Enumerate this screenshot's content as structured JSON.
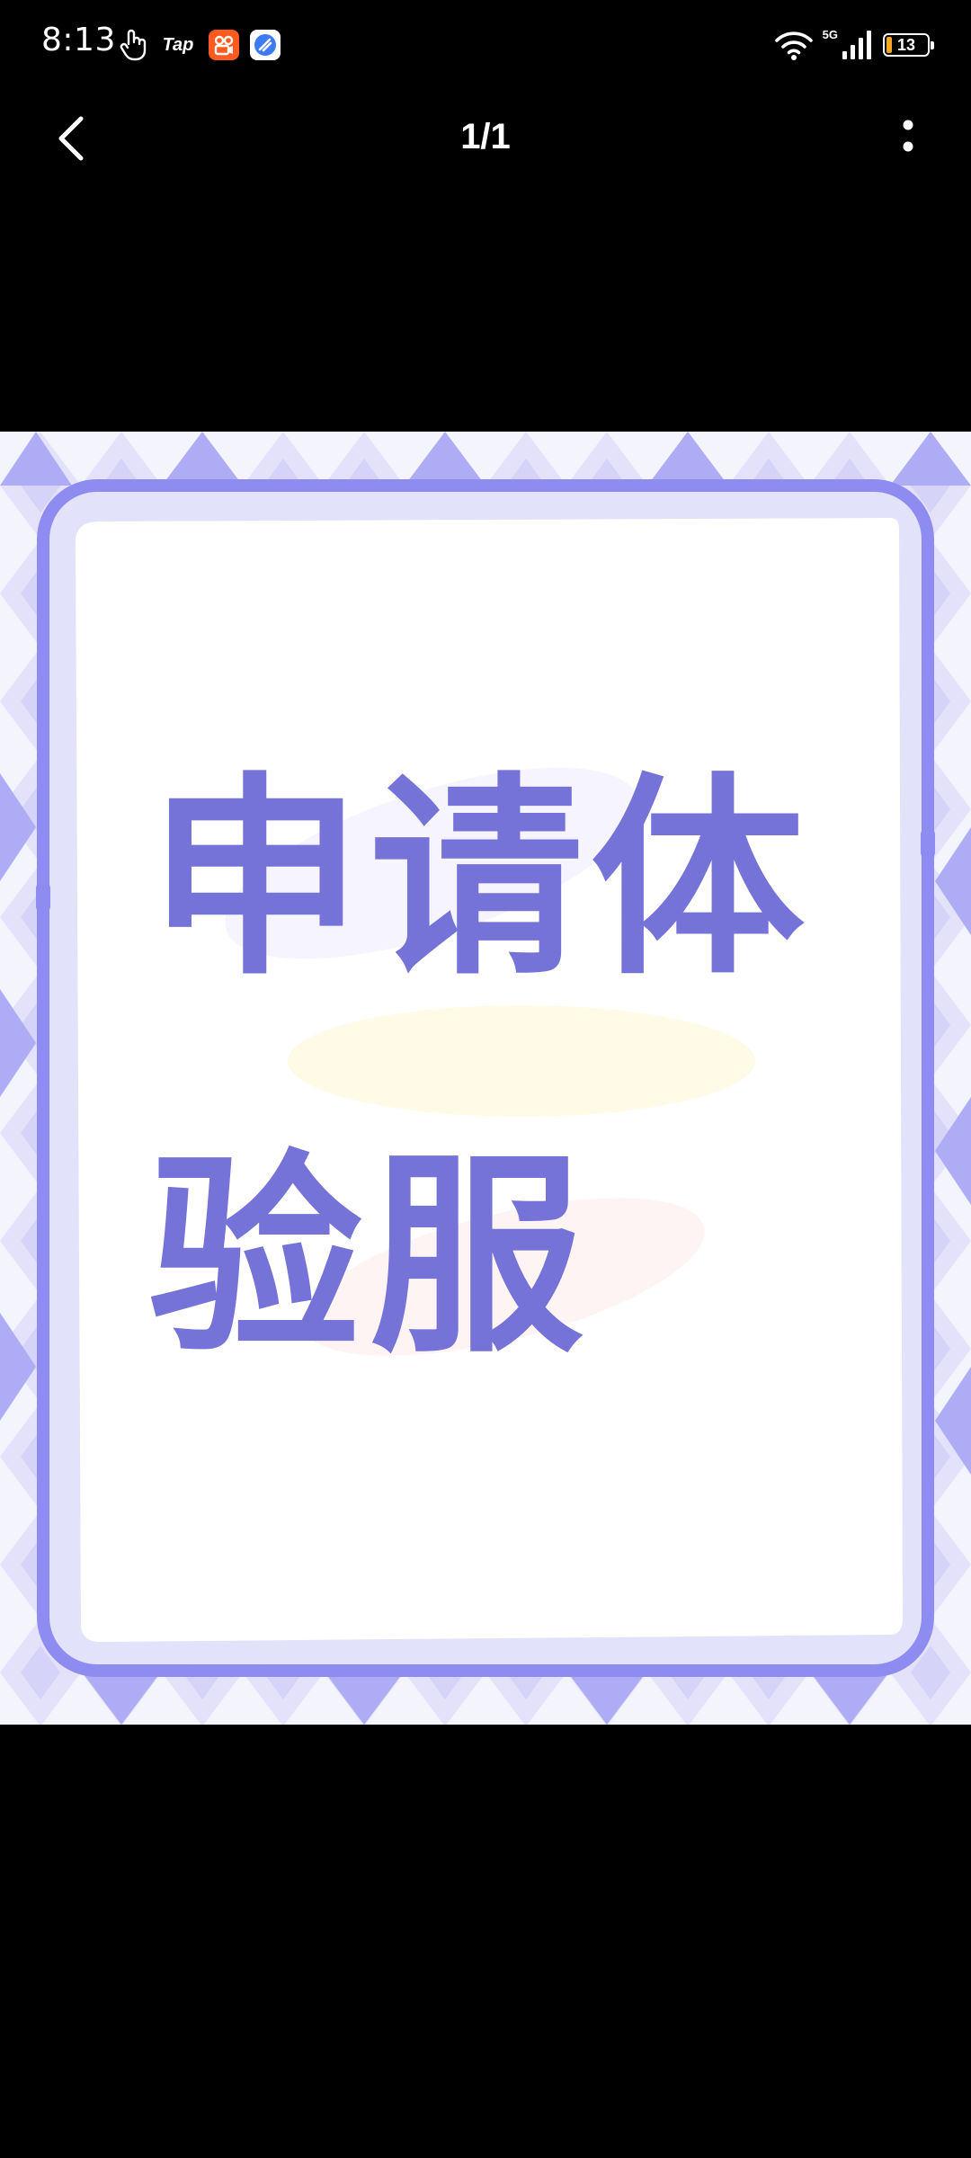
{
  "status_bar": {
    "time": "8:13",
    "left_icons": [
      "touch-gesture-icon",
      "tap-app-icon",
      "kuaishou-app-icon",
      "blue-app-icon"
    ],
    "tap_label": "Tap",
    "network_label": "5G",
    "battery_level": "13",
    "battery_color": "#f5a623",
    "right_icons": [
      "wifi-icon",
      "signal-icon",
      "battery-icon"
    ]
  },
  "top_nav": {
    "back_icon": "chevron-left-icon",
    "page_indicator": "1/1",
    "more_icon": "more-vertical-icon"
  },
  "poster": {
    "line_1": "申请体",
    "line_2": "验服",
    "text_color": "#7673d8",
    "frame_color": "#8e8cf0",
    "background_color": "#f4f4fc"
  }
}
